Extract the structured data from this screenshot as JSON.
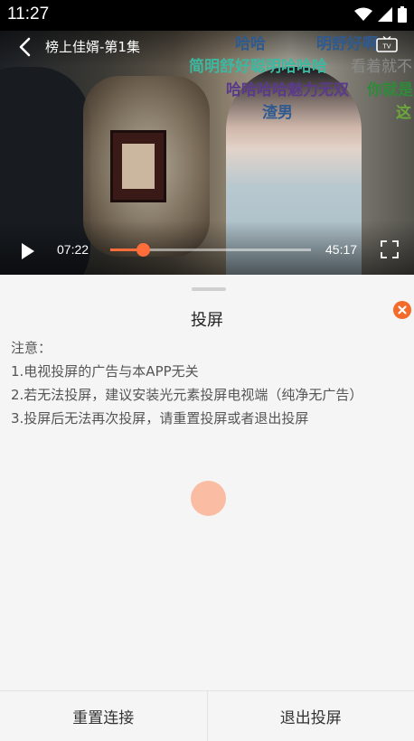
{
  "status": {
    "time": "11:27"
  },
  "player": {
    "title": "榜上佳婿-第1集",
    "current_time": "07:22",
    "total_time": "45:17",
    "progress_fraction": 0.163
  },
  "danmaku": [
    {
      "text": "哈哈",
      "color": "#2f5a8f"
    },
    {
      "text": "明舒好啊",
      "color": "#2f5a8f"
    },
    {
      "text": "简明舒好聪明哈哈哈",
      "color": "#3bb8a0"
    },
    {
      "text": "看着就不",
      "color": "#8a8a8a"
    },
    {
      "text": "哈哈哈哈魅力无双",
      "color": "#5a3a8a"
    },
    {
      "text": "你就是",
      "color": "#2f8a3a"
    },
    {
      "text": "渣男",
      "color": "#2f5a8f"
    },
    {
      "text": "这",
      "color": "#6aa83a"
    }
  ],
  "sheet": {
    "title": "投屏",
    "notes": [
      "注意：",
      "1.电视投屏的广告与本APP无关",
      "2.若无法投屏，建议安装光元素投屏电视端（纯净无广告）",
      "3.投屏后无法再次投屏，请重置投屏或者退出投屏"
    ],
    "reset_label": "重置连接",
    "exit_label": "退出投屏"
  },
  "colors": {
    "accent": "#ff6e3a",
    "close": "#f36a2b",
    "spinner": "#fbbca4"
  },
  "icons": [
    "wifi-icon",
    "signal-icon",
    "battery-icon",
    "back-icon",
    "tv-icon",
    "play-icon",
    "fullscreen-icon",
    "close-icon"
  ]
}
